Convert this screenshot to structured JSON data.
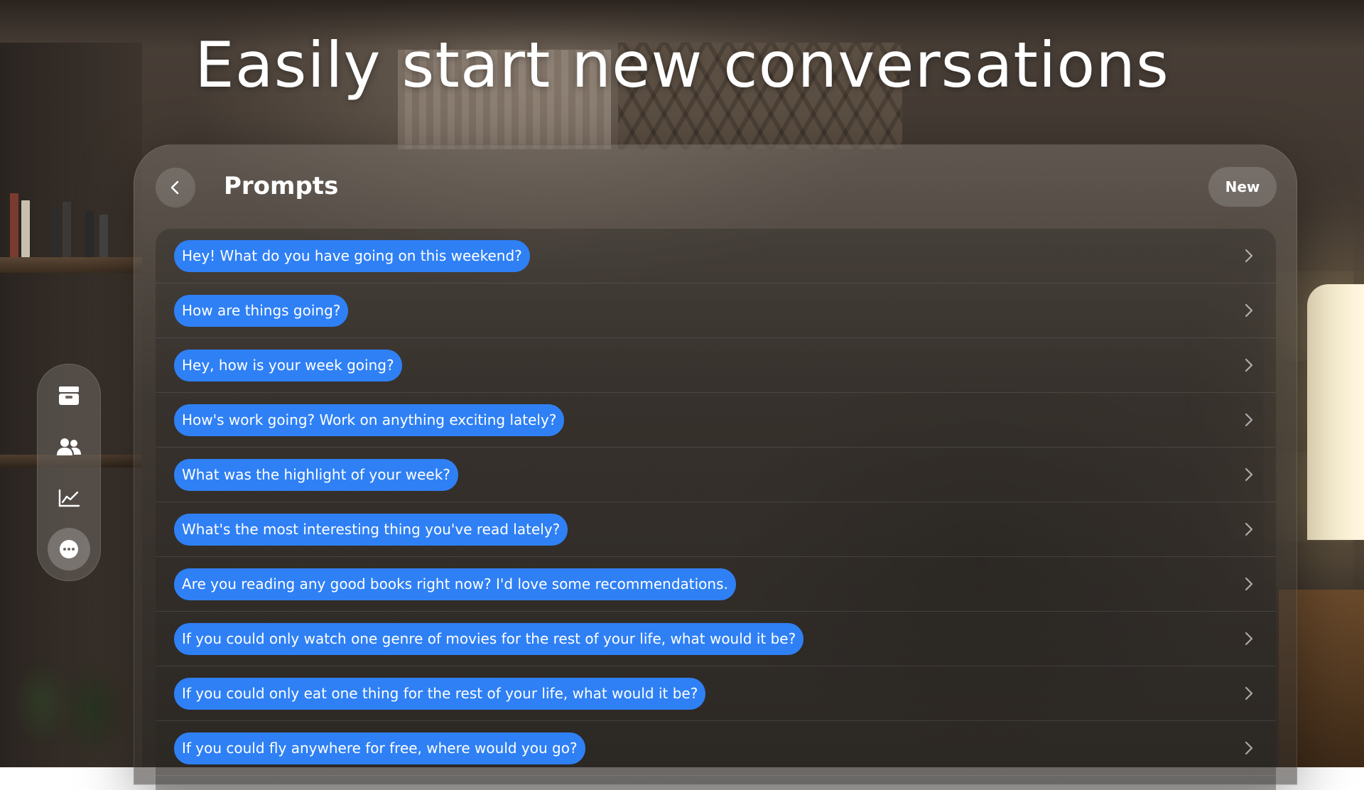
{
  "headline": "Easily start new conversations",
  "window": {
    "title": "Prompts",
    "new_button_label": "New"
  },
  "prompts": [
    "Hey! What do you have going on this weekend?",
    "How are things going?",
    "Hey, how is your week going?",
    "How's work going? Work on anything exciting lately?",
    "What was the highlight of your week?",
    "What's the most interesting thing you've read lately?",
    "Are you reading any good books right now? I'd love some recommendations.",
    "If you could only watch one genre of movies for the rest of your life, what would it be?",
    "If you could only eat one thing for the rest of your life, what would it be?",
    "If you could fly anywhere for free, where would you go?"
  ],
  "tabs": [
    {
      "icon": "tray-icon",
      "active": false
    },
    {
      "icon": "people-icon",
      "active": false
    },
    {
      "icon": "chart-icon",
      "active": false
    },
    {
      "icon": "chat-bubble-icon",
      "active": true
    }
  ],
  "colors": {
    "bubble": "#2f80f5",
    "text": "#ffffff"
  }
}
